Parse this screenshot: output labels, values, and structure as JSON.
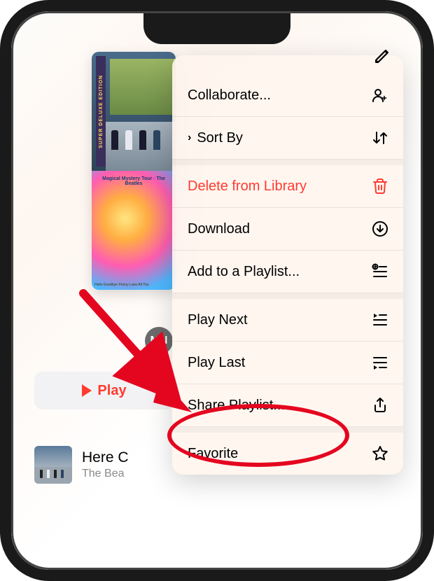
{
  "background": {
    "album_side_label": "SUPER DELUXE EDITION",
    "album2_top_text": "Magical Mystery Tour · The Beatles",
    "album2_bottom_text": "Hello Goodbye\nPenny Lane\nAll You",
    "avatar_initials": "MN",
    "play_button_label": "Play",
    "song_title": "Here C",
    "song_artist": "The Bea"
  },
  "menu": {
    "collaborate": "Collaborate...",
    "sort_by": "Sort By",
    "delete": "Delete from Library",
    "download": "Download",
    "add_playlist": "Add to a Playlist...",
    "play_next": "Play Next",
    "play_last": "Play Last",
    "share": "Share Playlist...",
    "favorite": "Favorite"
  },
  "annotation": {
    "highlighted_item": "share"
  }
}
